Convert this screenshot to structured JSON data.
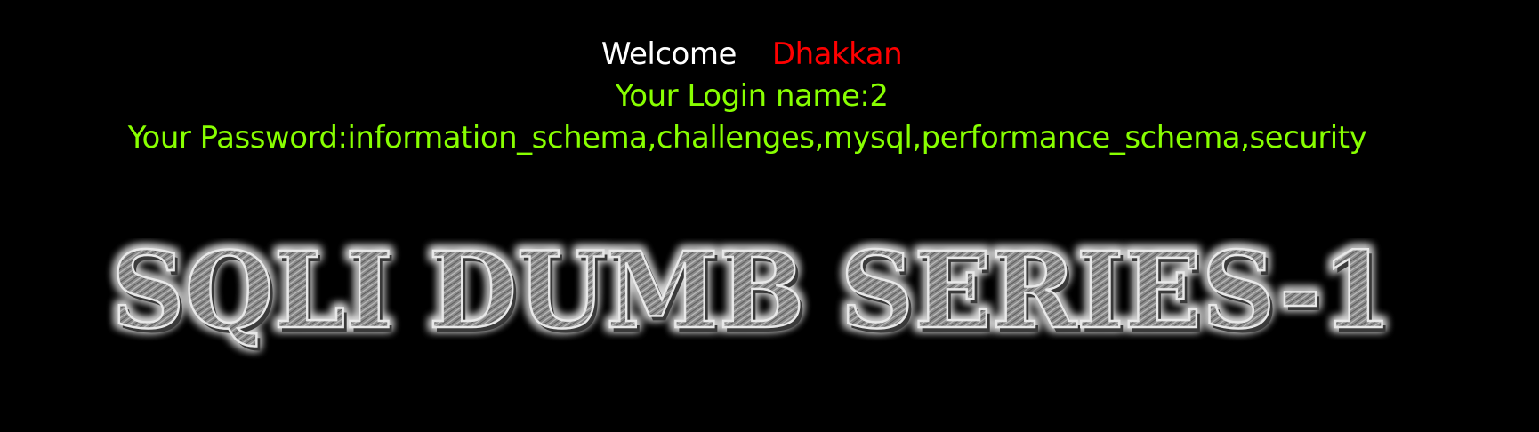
{
  "welcome": {
    "label": "Welcome",
    "username": "Dhakkan",
    "label_color": "#ffffff",
    "username_color": "#ff0000"
  },
  "login": {
    "name_line": "Your Login name:2",
    "password_line": "Your Password:information_schema,challenges,mysql,performance_schema,security",
    "text_color": "#88ff00"
  },
  "banner": {
    "text": "SQLI DUMB SERIES-1"
  },
  "page": {
    "background": "#000000"
  }
}
